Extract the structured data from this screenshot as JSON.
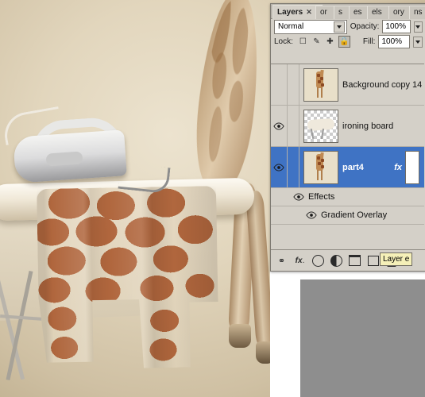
{
  "photo": {
    "description": "giraffe-on-ironing-board-photo"
  },
  "panel": {
    "tabs": [
      {
        "label": "Layers",
        "closable": true,
        "active": true
      },
      {
        "label": "or",
        "active": false
      },
      {
        "label": "s",
        "active": false
      },
      {
        "label": "es",
        "active": false
      },
      {
        "label": "els",
        "active": false
      },
      {
        "label": "ory",
        "active": false
      },
      {
        "label": "ns",
        "active": false
      }
    ],
    "blend_mode": "Normal",
    "opacity_label": "Opacity:",
    "opacity_value": "100%",
    "lock_label": "Lock:",
    "fill_label": "Fill:",
    "fill_value": "100%",
    "lock_buttons": [
      "lock-transparent-pixels",
      "lock-image-pixels",
      "lock-position",
      "lock-all"
    ],
    "layers": [
      {
        "name": "Background copy 14",
        "visible": false,
        "selected": false,
        "has_fx": false,
        "thumb": "giraffe",
        "mask": false
      },
      {
        "name": "ironing board",
        "visible": true,
        "selected": false,
        "has_fx": false,
        "thumb": "transparent",
        "mask": false
      },
      {
        "name": "part4",
        "visible": true,
        "selected": true,
        "has_fx": true,
        "fx_label": "fx",
        "thumb": "giraffe",
        "mask": true
      }
    ],
    "effects": [
      {
        "label": "Effects",
        "visible": true,
        "indent": 0
      },
      {
        "label": "Gradient Overlay",
        "visible": true,
        "indent": 1
      }
    ],
    "footer_buttons": [
      "link-layers-button",
      "add-layer-style-button",
      "add-layer-mask-button",
      "create-adjustment-layer-button",
      "create-group-button",
      "create-new-layer-button",
      "delete-layer-button"
    ],
    "tooltip": "Layer e"
  }
}
